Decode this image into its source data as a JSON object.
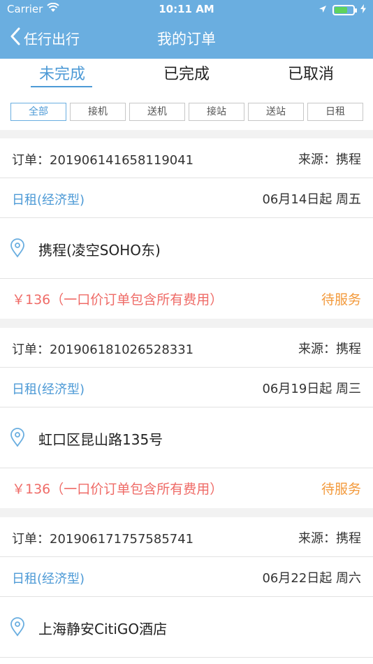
{
  "status_bar": {
    "carrier": "Carrier",
    "time": "10:11 AM"
  },
  "nav": {
    "back_label": "任行出行",
    "title": "我的订单"
  },
  "tabs": [
    "未完成",
    "已完成",
    "已取消"
  ],
  "filters": [
    "全部",
    "接机",
    "送机",
    "接站",
    "送站",
    "日租"
  ],
  "colors": {
    "header": "#6aaee0",
    "accent": "#4d9ad6",
    "price": "#ef6b67",
    "status": "#f39a3c"
  },
  "orders": [
    {
      "order_label": "订单：201906141658119041",
      "source": "来源：携程",
      "service": "日租(经济型)",
      "date": "06月14日起 周五",
      "address": "携程(凌空SOHO东)",
      "price": "￥136（一口价订单包含所有费用）",
      "status": "待服务"
    },
    {
      "order_label": "订单：201906181026528331",
      "source": "来源：携程",
      "service": "日租(经济型)",
      "date": "06月19日起 周三",
      "address": "虹口区昆山路135号",
      "price": "￥136（一口价订单包含所有费用）",
      "status": "待服务"
    },
    {
      "order_label": "订单：201906171757585741",
      "source": "来源：携程",
      "service": "日租(经济型)",
      "date": "06月22日起 周六",
      "address": "上海静安CitiGO酒店"
    }
  ]
}
